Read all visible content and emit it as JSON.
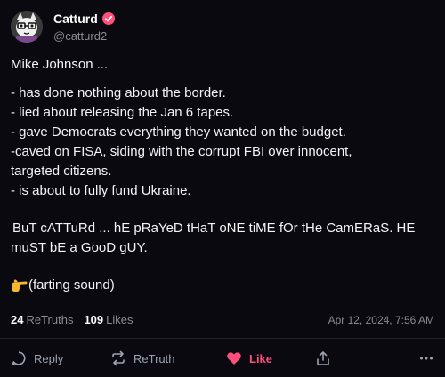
{
  "author": {
    "display_name": "Catturd",
    "handle": "@catturd2",
    "verified": true
  },
  "post": {
    "lines": {
      "intro": "Mike Johnson ...",
      "item1": "- has done nothing about the border.",
      "item2": "- lied about releasing the Jan 6 tapes.",
      "item3": "- gave Democrats everything they wanted on the budget.",
      "item4a": "-caved on FISA, siding with the corrupt FBI over innocent,",
      "item4b": "targeted citizens.",
      "item5": "- is about to fully fund Ukraine.",
      "shout1": "BuT cATTuRd ... hE pRaYeD tHaT oNE tiME fOr tHe CamERaS. HE",
      "shout2": "muST bE a GooD gUY.",
      "closing": "(farting sound)"
    }
  },
  "stats": {
    "retruths_count": "24",
    "retruths_label": "ReTruths",
    "likes_count": "109",
    "likes_label": "Likes",
    "timestamp": "Apr 12, 2024, 7:56 AM"
  },
  "actions": {
    "reply": "Reply",
    "retruth": "ReTruth",
    "like": "Like"
  },
  "icons": [
    "avatar-cat-icon",
    "verified-badge-icon",
    "pointing-hand-icon",
    "reply-icon",
    "retruth-icon",
    "heart-icon",
    "share-icon",
    "more-icon"
  ],
  "colors": {
    "background": "#09090f",
    "verified": "#ff4f7a",
    "like_active": "#ff4f7a",
    "muted": "#8b8b95"
  }
}
